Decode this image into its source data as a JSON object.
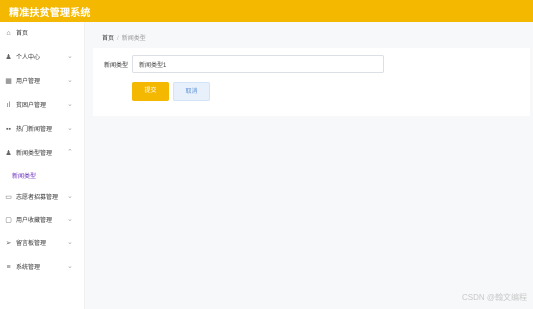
{
  "header": {
    "title": "精准扶贫管理系统",
    "bg_color": "#f5b800"
  },
  "sidebar": {
    "items": [
      {
        "label": "首页",
        "icon": "home-icon",
        "glyph": "⌂",
        "has_chevron": false
      },
      {
        "label": "个人中心",
        "icon": "user-icon",
        "glyph": "♟",
        "has_chevron": true
      },
      {
        "label": "用户管理",
        "icon": "grid-icon",
        "glyph": "▦",
        "has_chevron": true
      },
      {
        "label": "贫困户管理",
        "icon": "bar-chart-icon",
        "glyph": "ıl",
        "has_chevron": true
      },
      {
        "label": "热门新闻管理",
        "icon": "apps-icon",
        "glyph": "▪▪",
        "has_chevron": true
      },
      {
        "label": "新闻类型管理",
        "icon": "user-icon",
        "glyph": "♟",
        "has_chevron": true,
        "expanded": true
      },
      {
        "label": "志愿者招募管理",
        "icon": "card-icon",
        "glyph": "▭",
        "has_chevron": true
      },
      {
        "label": "用户收藏管理",
        "icon": "chat-icon",
        "glyph": "▢",
        "has_chevron": true
      },
      {
        "label": "留言板管理",
        "icon": "send-icon",
        "glyph": "➢",
        "has_chevron": true
      },
      {
        "label": "系统管理",
        "icon": "list-icon",
        "glyph": "≡",
        "has_chevron": true
      }
    ],
    "sub_item": {
      "label": "新闻类型"
    }
  },
  "breadcrumb": {
    "home": "首页",
    "separator": "/",
    "current": "新闻类型"
  },
  "form": {
    "label": "新闻类型",
    "input_value": "新闻类型1",
    "submit_label": "提交",
    "cancel_label": "取消"
  },
  "watermark": "CSDN @翰文编程"
}
